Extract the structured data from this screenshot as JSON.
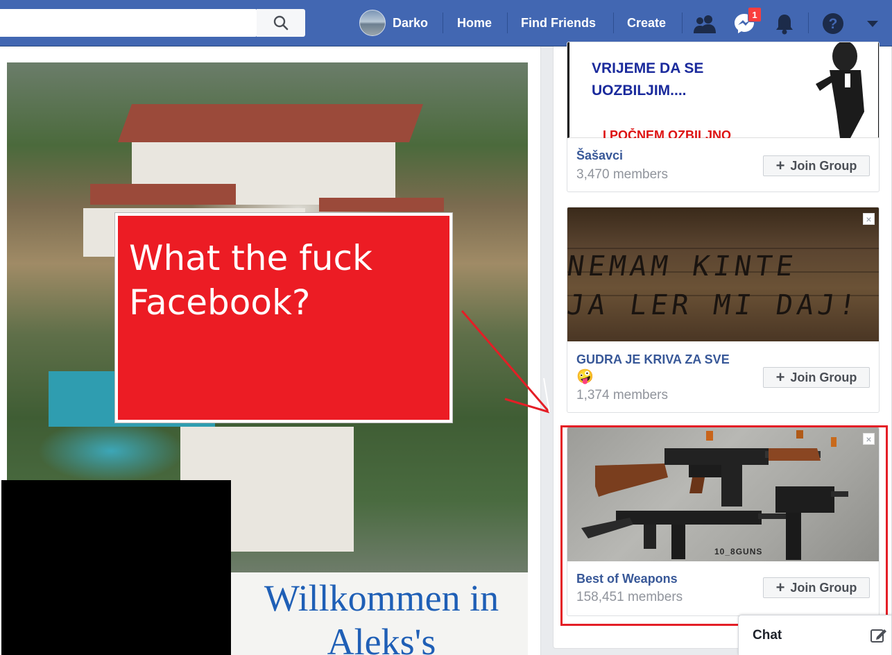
{
  "header": {
    "search_placeholder": "",
    "profile_name": "Darko",
    "nav": [
      "Home",
      "Find Friends",
      "Create"
    ],
    "messenger_badge": "1",
    "icons": [
      "search-icon",
      "friends-icon",
      "messenger-icon",
      "bell-icon",
      "help-icon",
      "chevron-down-icon"
    ]
  },
  "post": {
    "welcome_line1": "Willkommen in",
    "welcome_line2": "Aleks's"
  },
  "annotation": {
    "callout_text": "What the fuck Facebook?",
    "highlight_color": "#e41e26"
  },
  "suggested_groups": [
    {
      "image_text_lines": [
        "VRIJEME DA SE",
        "UOZBILJIM....",
        "I POČNEM OZBILJNO"
      ],
      "name": "Šašavci",
      "members": "3,470 members",
      "join_label": "Join Group"
    },
    {
      "image_text_lines": [
        "NEMAM KINTE",
        "JA LER MI DAJ!"
      ],
      "name": "GUDRA JE KRIVA ZA SVE",
      "emoji": "🤪",
      "members": "1,374 members",
      "join_label": "Join Group",
      "close_label": "×"
    },
    {
      "image_watermark": "10_8GUNS",
      "name": "Best of Weapons",
      "members": "158,451 members",
      "join_label": "Join Group",
      "close_label": "×"
    }
  ],
  "chat": {
    "label": "Chat"
  },
  "colors": {
    "brand_blue": "#4267b2",
    "link_blue": "#385898",
    "callout_red": "#ec1c24"
  }
}
